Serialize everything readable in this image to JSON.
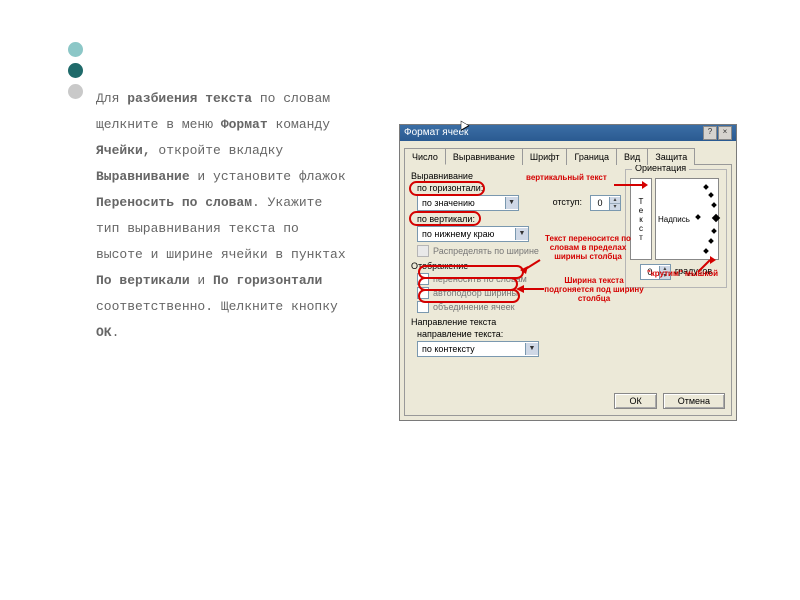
{
  "instruction": {
    "run1": "Для ",
    "bold1": "разбиения текста",
    "run2": " по словам щелкните в меню ",
    "bold2": "Формат",
    "run3": " команду ",
    "bold3": "Ячейки,",
    "run4": " откройте вкладку ",
    "bold4": "Выравнивание",
    "run5": " и установите флажок ",
    "bold5": "Переносить по словам",
    "run6": ". Укажите тип выравнивания текста по высоте и ширине ячейки в пунктах ",
    "bold6": "По вертикали",
    "run7": " и ",
    "bold7": "По горизонтали",
    "run8": " соответственно. Щелкните кнопку ",
    "bold8": "ОК",
    "run9": "."
  },
  "dialog": {
    "title": "Формат ячеек",
    "help_btn": "?",
    "close_btn": "×",
    "tabs": [
      "Число",
      "Выравнивание",
      "Шрифт",
      "Граница",
      "Вид",
      "Защита"
    ],
    "active_tab_index": 1,
    "groups": {
      "align": {
        "legend": "Выравнивание",
        "horiz_label": "по горизонтали:",
        "horiz_value": "по значению",
        "vert_label": "по вертикали:",
        "vert_value": "по нижнему краю",
        "indent_label": "отступ:",
        "indent_value": "0",
        "distribute_label": "Распределять по ширине"
      },
      "display": {
        "legend": "Отображение",
        "wrap_label": "переносить по словам",
        "autofit_label": "автоподбор ширины",
        "merge_label": "объединение ячеек"
      },
      "direction": {
        "legend": "Направление текста",
        "dir_label": "направление текста:",
        "dir_value": "по контексту"
      },
      "orientation": {
        "legend": "Ориентация",
        "vertical_letters": [
          "Т",
          "е",
          "к",
          "с",
          "т"
        ],
        "nadpis": "Надпись",
        "deg_value": "0",
        "deg_label": "градусов"
      }
    },
    "buttons": {
      "ok": "ОК",
      "cancel": "Отмена"
    }
  },
  "annotations": {
    "vertical_text": "вертикальный текст",
    "wrap_note": "Текст переносится по словам в пределах ширины столбца",
    "autofit_note": "Ширина текста подгоняется под ширину столбца",
    "rotate_note": "\"крутим\" мышкой"
  }
}
